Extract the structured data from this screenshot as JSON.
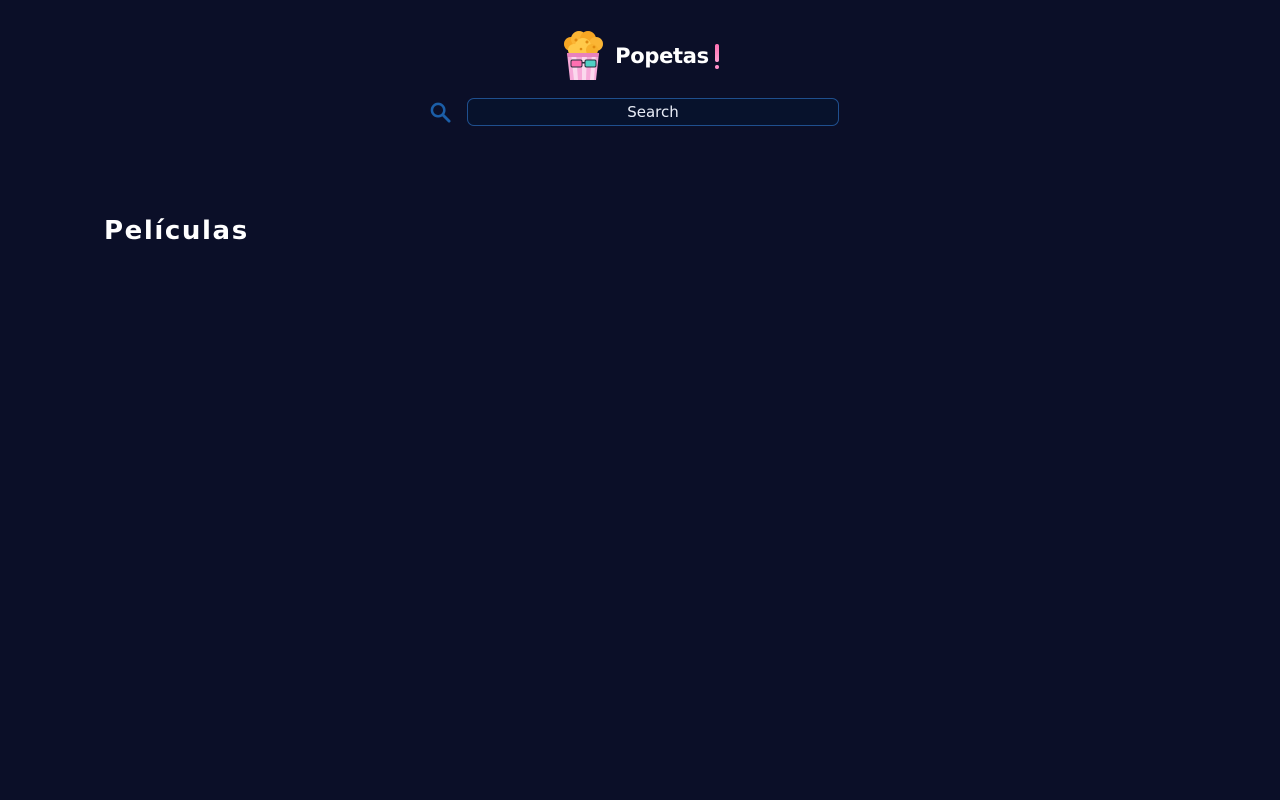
{
  "header": {
    "brand_name": "Popetas",
    "logo_icon": "popcorn-bucket-icon",
    "accent_color": "#ff7fc0"
  },
  "search": {
    "icon": "search-icon",
    "placeholder": "Search",
    "value": "",
    "border_color": "#1f4f8e"
  },
  "main": {
    "section_title": "Películas",
    "movies": []
  },
  "colors": {
    "background": "#0b0f28",
    "text": "#ffffff",
    "search_icon": "#1b5ea8"
  }
}
